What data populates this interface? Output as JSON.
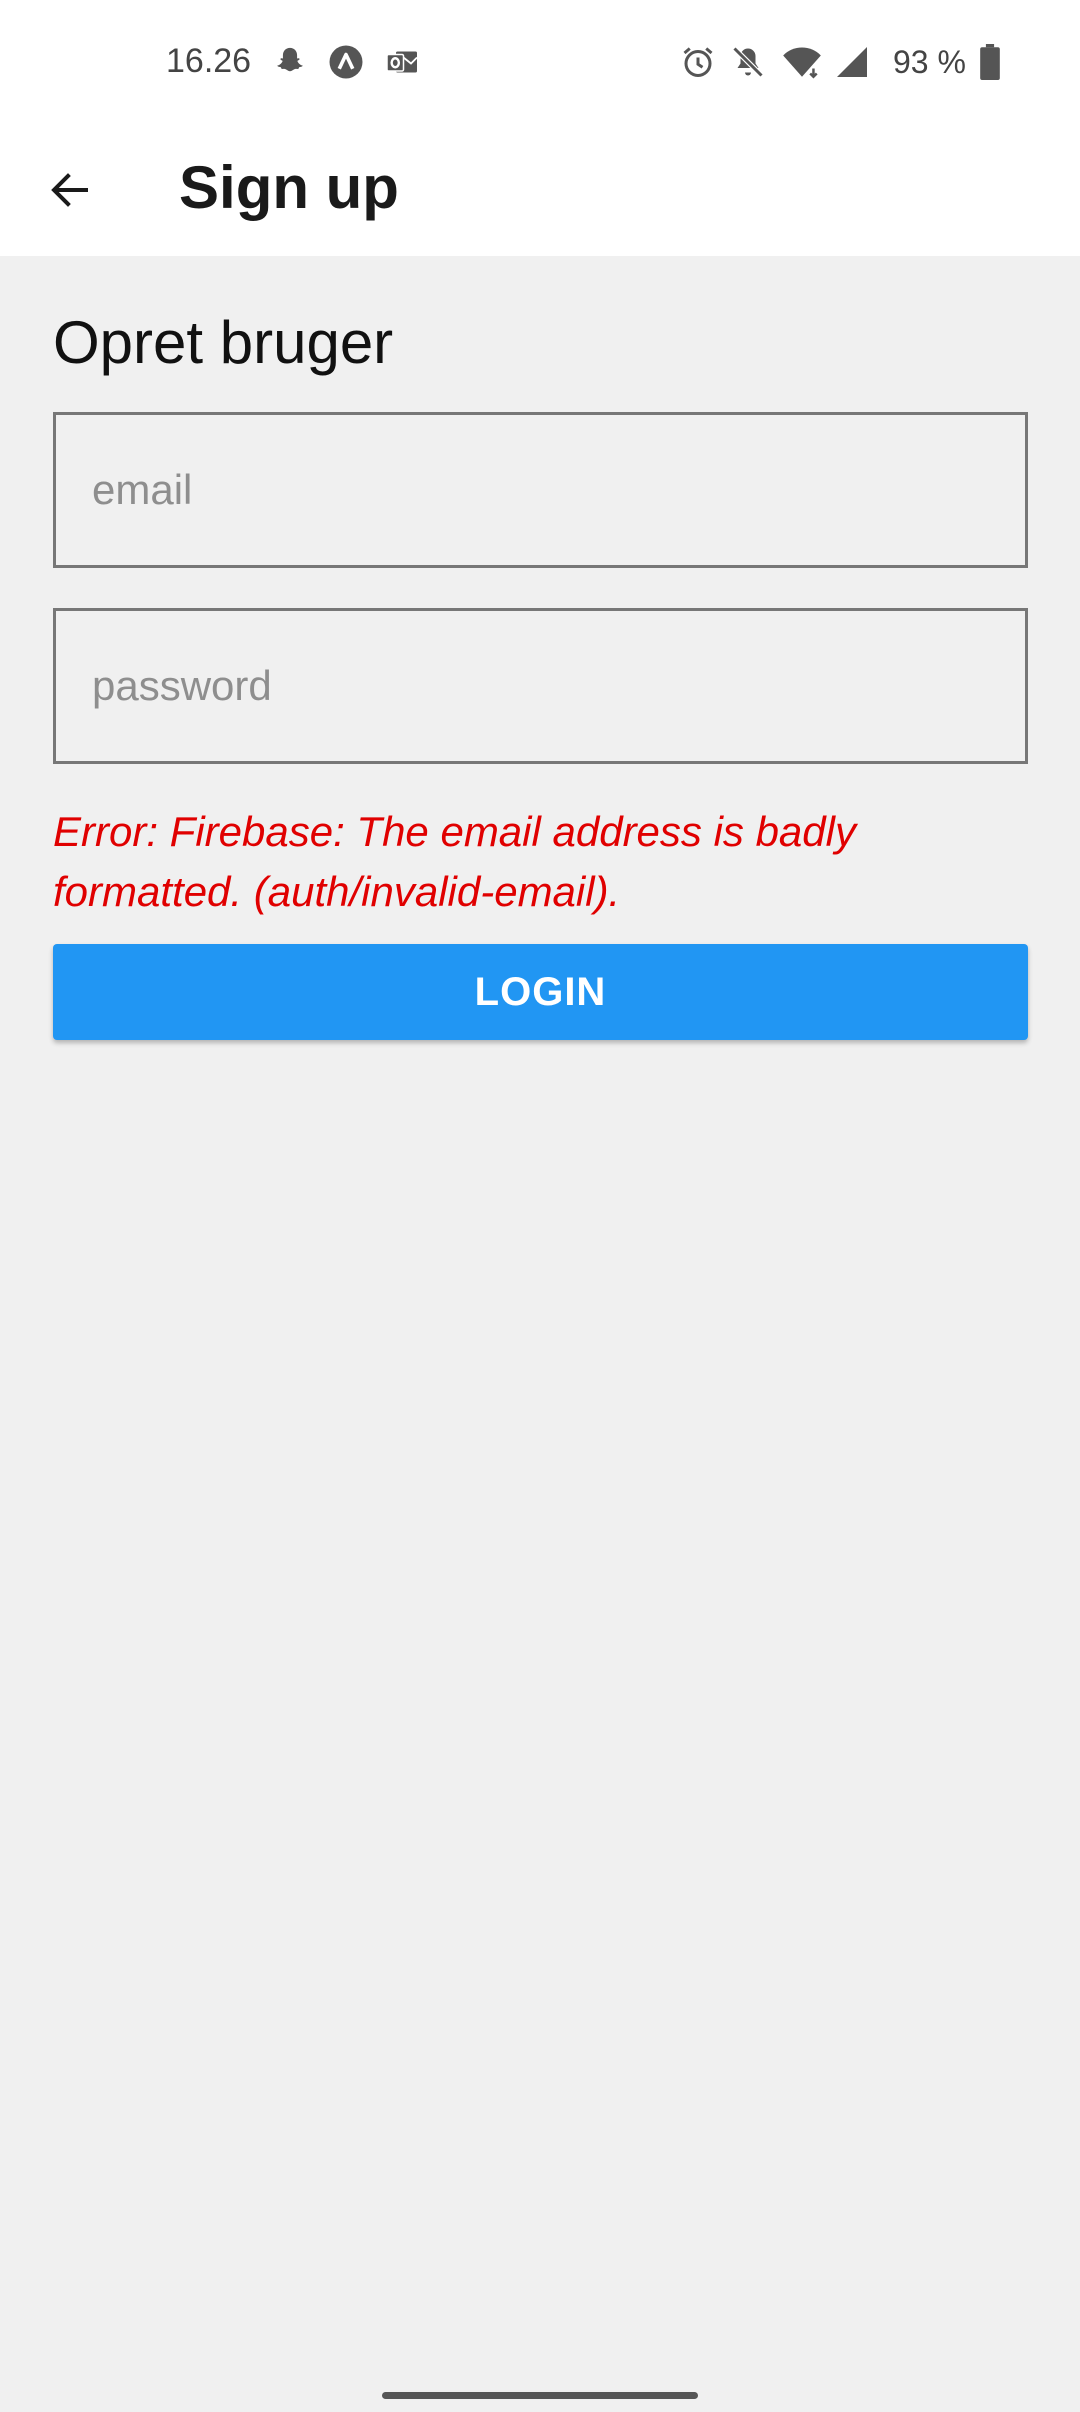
{
  "status_bar": {
    "time": "16.26",
    "battery_percent": "93 %",
    "icons": [
      "snapchat-icon",
      "app-notification-icon",
      "outlook-icon",
      "alarm-icon",
      "bell-off-icon",
      "wifi-icon",
      "signal-icon",
      "battery-icon"
    ]
  },
  "app_bar": {
    "title": "Sign up"
  },
  "form": {
    "heading": "Opret bruger",
    "email_placeholder": "email",
    "email_value": "",
    "password_placeholder": "password",
    "password_value": "",
    "error_message": "Error: Firebase: The email address is badly formatted. (auth/invalid-email).",
    "submit_label": "LOGIN"
  },
  "colors": {
    "primary": "#2196f3",
    "error": "#e00000",
    "background": "#f0f0f0"
  }
}
